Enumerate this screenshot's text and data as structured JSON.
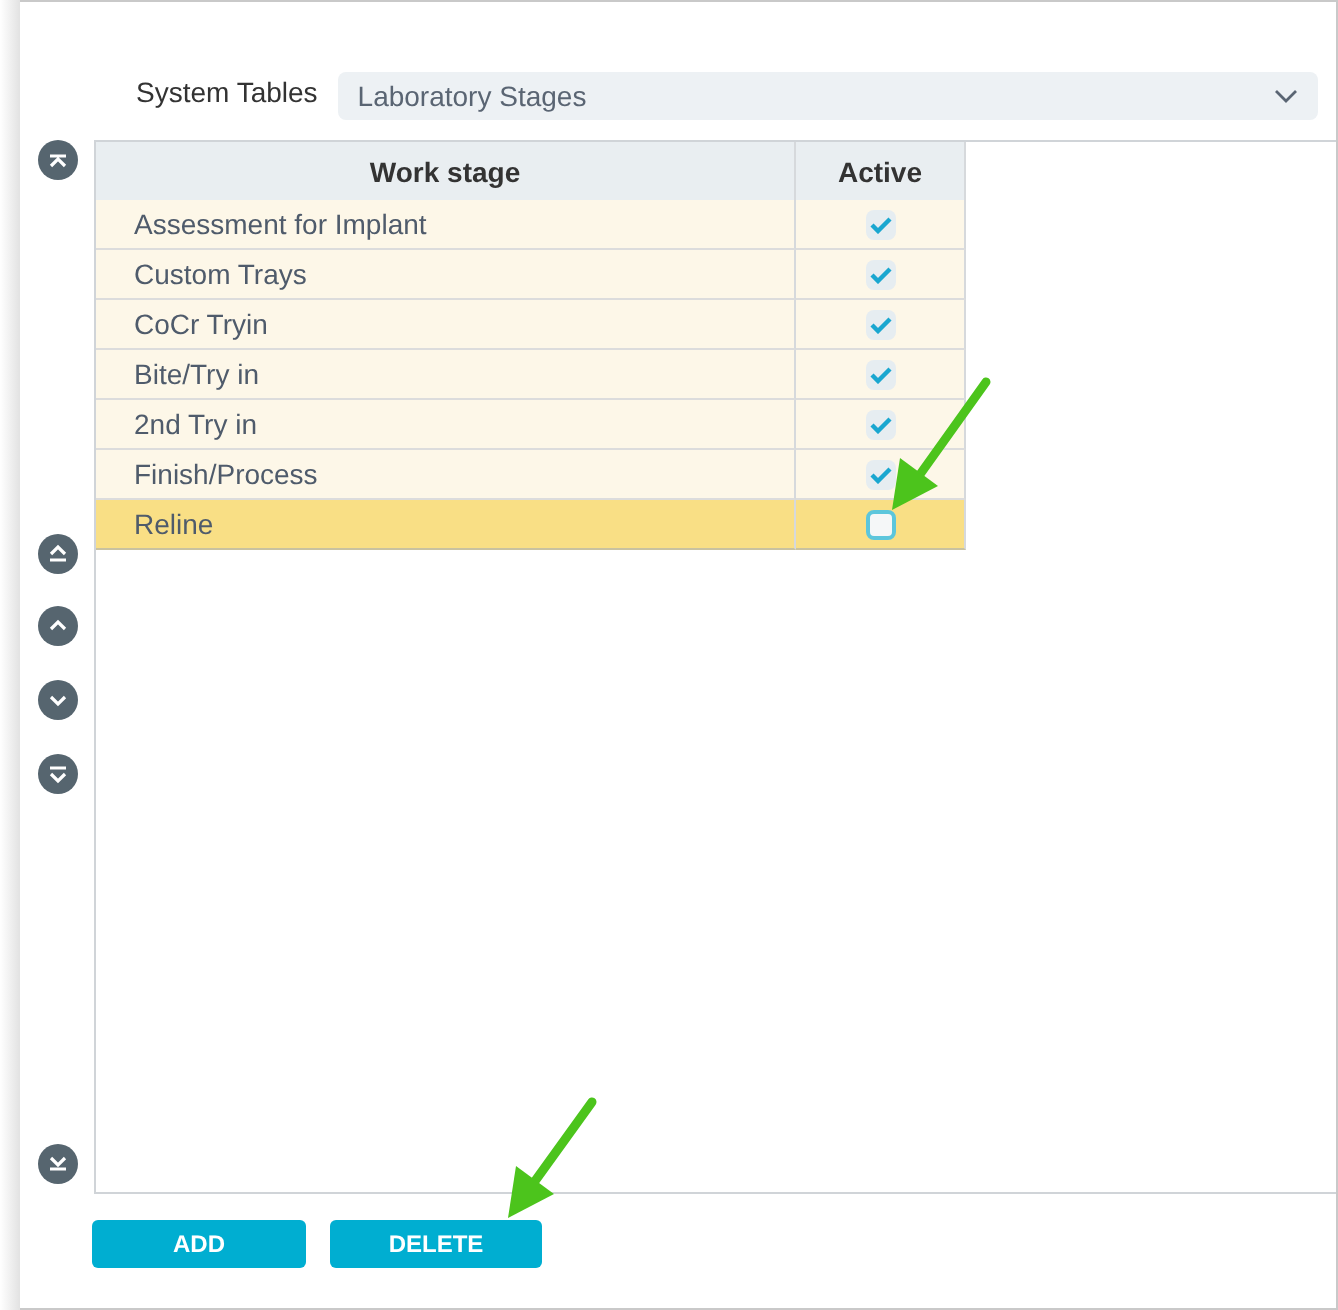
{
  "system_tables": {
    "label": "System Tables",
    "value": "Laboratory Stages"
  },
  "table": {
    "columns": [
      "Work stage",
      "Active"
    ],
    "rows": [
      {
        "work_stage": "Assessment for Implant",
        "active": true,
        "selected": false
      },
      {
        "work_stage": "Custom Trays",
        "active": true,
        "selected": false
      },
      {
        "work_stage": "CoCr Tryin",
        "active": true,
        "selected": false
      },
      {
        "work_stage": "Bite/Try in",
        "active": true,
        "selected": false
      },
      {
        "work_stage": "2nd Try in",
        "active": true,
        "selected": false
      },
      {
        "work_stage": "Finish/Process",
        "active": true,
        "selected": false
      },
      {
        "work_stage": "Reline",
        "active": false,
        "selected": true
      }
    ]
  },
  "buttons": [
    "ADD",
    "DELETE"
  ]
}
